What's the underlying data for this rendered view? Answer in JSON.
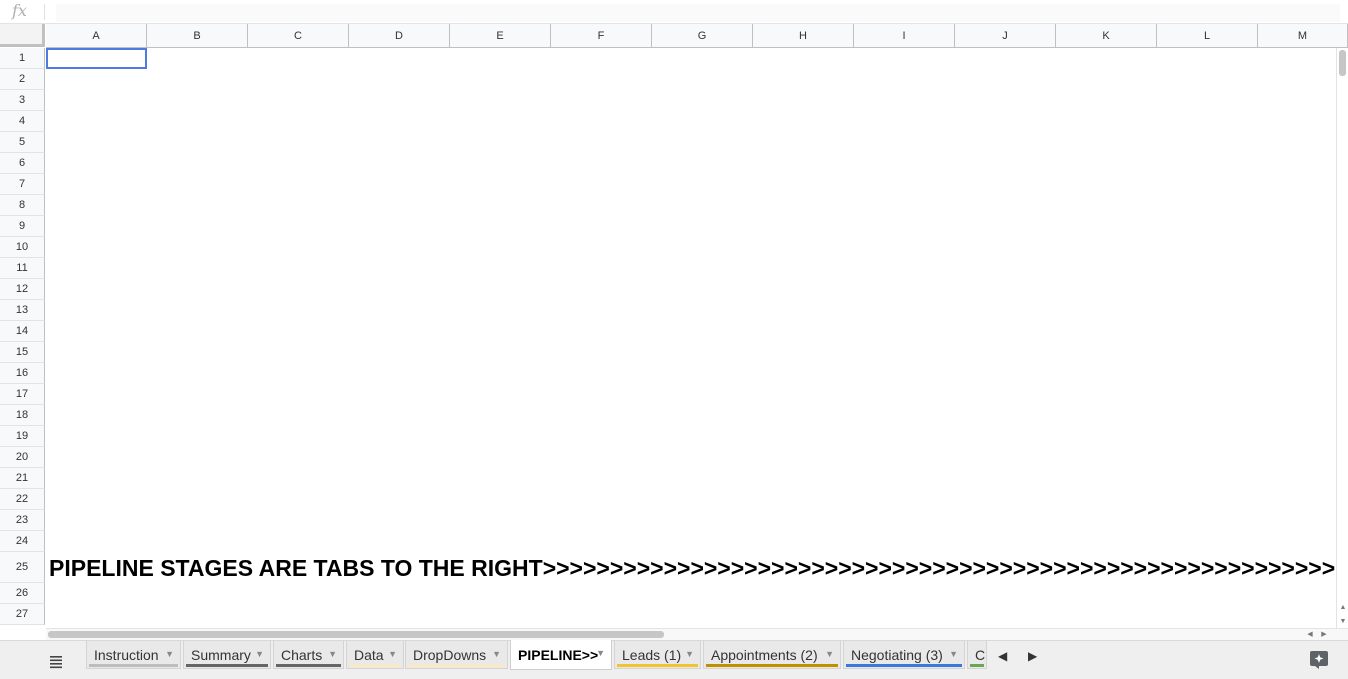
{
  "formula_bar": {
    "fx_label": "fx",
    "value": ""
  },
  "columns": [
    "A",
    "B",
    "C",
    "D",
    "E",
    "F",
    "G",
    "H",
    "I",
    "J",
    "K",
    "L",
    "M"
  ],
  "rows": [
    "1",
    "2",
    "3",
    "4",
    "5",
    "6",
    "7",
    "8",
    "9",
    "10",
    "11",
    "12",
    "13",
    "14",
    "15",
    "16",
    "17",
    "18",
    "19",
    "20",
    "21",
    "22",
    "23",
    "24",
    "25",
    "26",
    "27"
  ],
  "selected_cell": "A1",
  "cell_a25": "PIPELINE STAGES ARE TABS TO THE RIGHT>>>>>>>>>>>>>>>>>>>>>>>>>>>>>>>>>>>>>>>>>>>>>>>>>>>>>>>>>>>>>>>>>>>>>>>>>>>",
  "tabs": [
    {
      "label": "Instruction",
      "color": "#bdbdbd"
    },
    {
      "label": "Summary",
      "color": "#666666"
    },
    {
      "label": "Charts",
      "color": "#666666"
    },
    {
      "label": "Data",
      "color": "#fbe8c4"
    },
    {
      "label": "DropDowns",
      "color": "#fbe8c4"
    },
    {
      "label": "PIPELINE>>",
      "color": ""
    },
    {
      "label": "Leads (1)",
      "color": "#f1c232"
    },
    {
      "label": "Appointments (2)",
      "color": "#bf9000"
    },
    {
      "label": "Negotiating (3)",
      "color": "#3c78d8"
    },
    {
      "label": "C",
      "color": "#6aa84f"
    }
  ],
  "active_tab": "PIPELINE>>",
  "icons": {
    "sheet_list": "menu-lines-icon",
    "scroll_left": "arrow-left-icon",
    "scroll_right": "arrow-right-icon",
    "explore": "explore-icon"
  }
}
